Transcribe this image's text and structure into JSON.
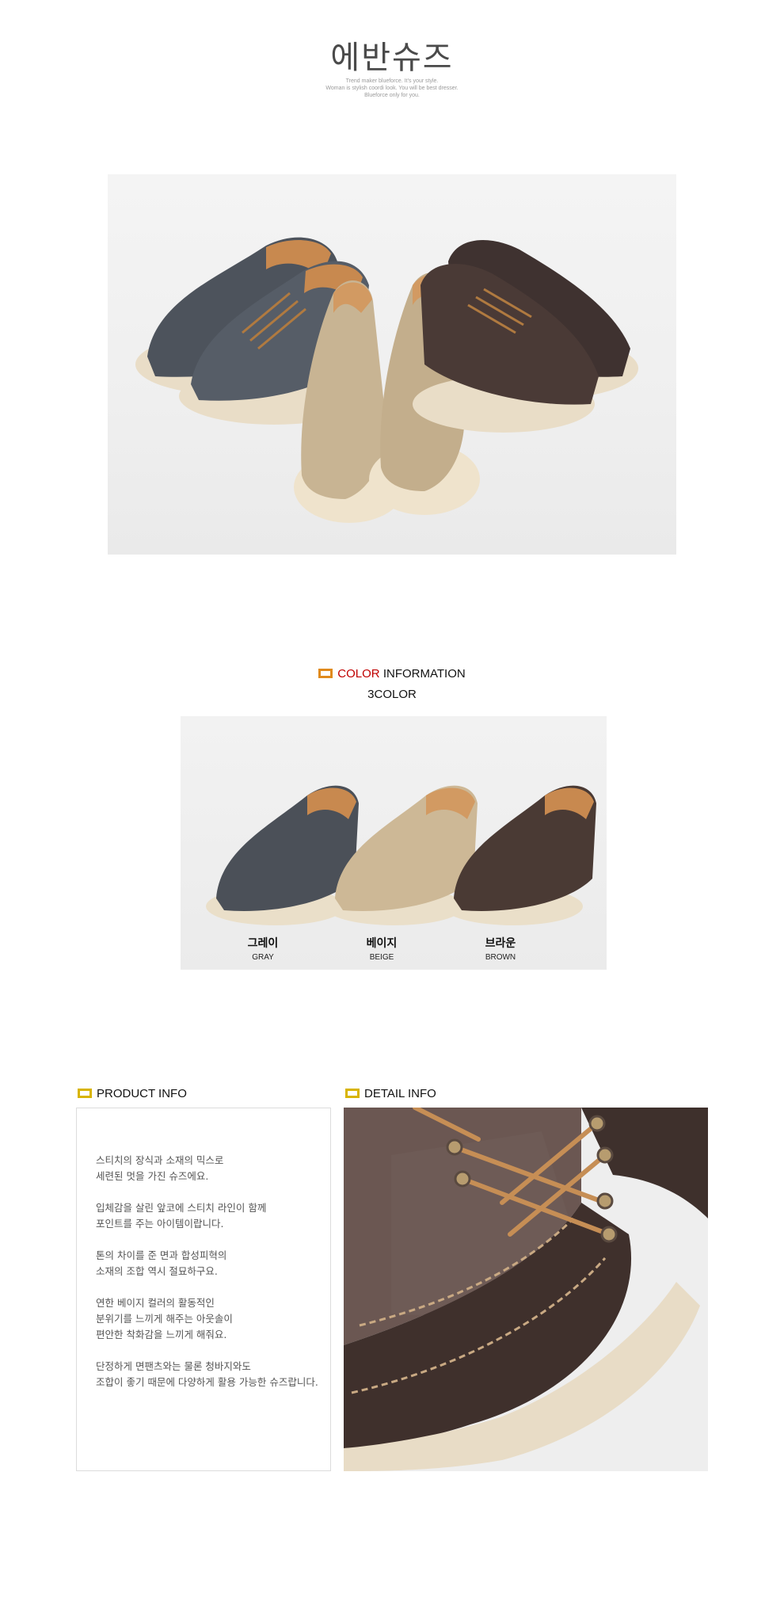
{
  "header": {
    "title": "에반슈즈",
    "tagline_1": "Trend maker blueforce. It’s your style.",
    "tagline_2": "Woman is stylish coordi look. You will be best dresser.",
    "tagline_3": "Blueforce only for you."
  },
  "color_section": {
    "heading_accent": "COLOR",
    "heading_rest": "INFORMATION",
    "count_label": "3COLOR",
    "swatches": [
      {
        "name_ko": "그레이",
        "name_en": "GRAY",
        "color": "#4b5058"
      },
      {
        "name_ko": "베이지",
        "name_en": "BEIGE",
        "color": "#cdb896"
      },
      {
        "name_ko": "브라운",
        "name_en": "BROWN",
        "color": "#4a3a34"
      }
    ]
  },
  "product_info": {
    "heading": "PRODUCT INFO",
    "paragraphs": [
      "스티치의 장식과 소재의 믹스로\n세련된 멋을 가진 슈즈에요.",
      "입체감을 살린 앞코에 스티치 라인이 함께\n포인트를 주는 아이템이랍니다.",
      "톤의 차이를 준 면과 합성피혁의\n소재의 조합 역시 절묘하구요.",
      "연한 베이지 컬러의 활동적인\n분위기를 느끼게 해주는 아웃솔이\n편안한 착화감을 느끼게 해줘요.",
      "단정하게 면팬츠와는 물론 청바지와도\n조합이 좋기 때문에 다양하게 활용 가능한 슈즈랍니다."
    ]
  },
  "detail_info": {
    "heading": "DETAIL INFO"
  },
  "colors": {
    "accent_yellow": "#d8b400",
    "accent_orange": "#e08a1c",
    "accent_red": "#c00000"
  }
}
